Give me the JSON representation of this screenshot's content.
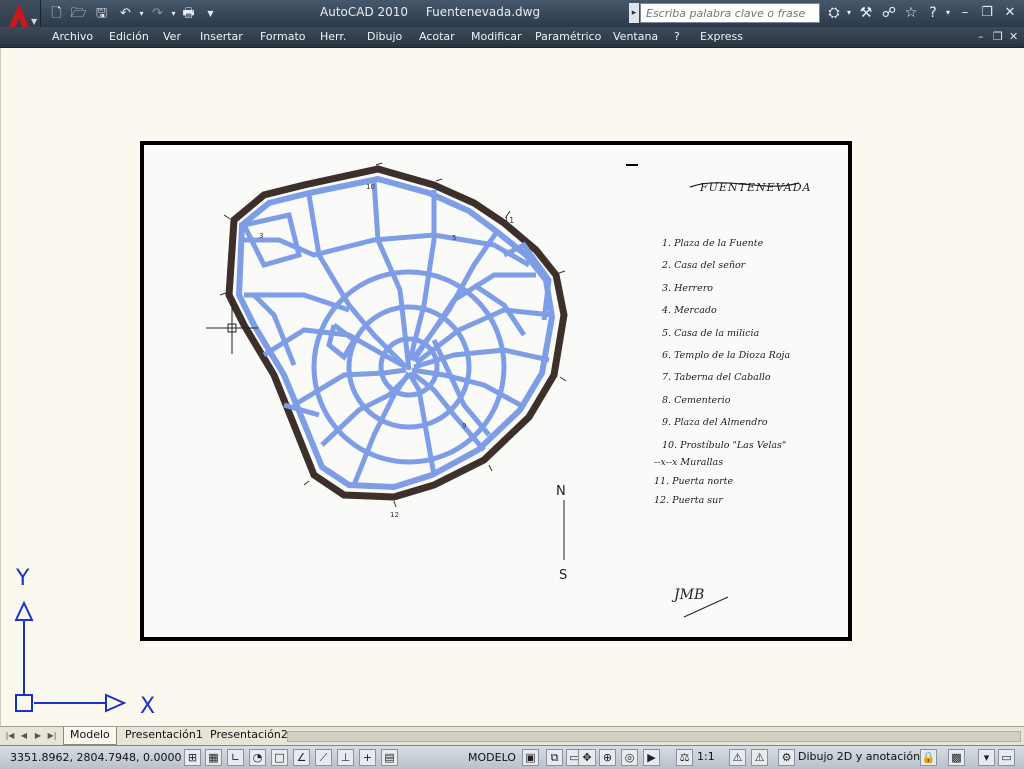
{
  "window": {
    "app_name": "AutoCAD 2010",
    "file_name": "Fuentenevada.dwg",
    "search_placeholder": "Escriba palabra clave o frase"
  },
  "menu": {
    "items": [
      "Archivo",
      "Edición",
      "Ver",
      "Insertar",
      "Formato",
      "Herr.",
      "Dibujo",
      "Acotar",
      "Modificar",
      "Paramétrico",
      "Ventana",
      "?",
      "Express"
    ]
  },
  "drawing": {
    "title": "FUENTENEVADA",
    "legend": [
      "1. Plaza de la Fuente",
      "2. Casa del señor",
      "3. Herrero",
      "4. Mercado",
      "5. Casa de la milicia",
      "6. Templo de la Dioza Roja",
      "7. Taberna del Caballo",
      "8. Cementerio",
      "9. Plaza del Almendro",
      "10. Prostíbulo \"Las Velas\""
    ],
    "legend_extra": [
      "--x--x  Murallas",
      "11. Puerta norte",
      "12. Puerta sur"
    ],
    "compass_n": "N",
    "compass_s": "S",
    "signature": "JMB",
    "map_labels": [
      "10",
      "11",
      "12",
      "3",
      "5",
      "9"
    ]
  },
  "ucs": {
    "x_label": "X",
    "y_label": "Y"
  },
  "tabs": {
    "items": [
      "Modelo",
      "Presentación1",
      "Presentación2"
    ]
  },
  "status": {
    "coords": "3351.8962, 2804.7948, 0.0000",
    "modelo": "MODELO",
    "scale": "1:1",
    "workspace": "Dibujo 2D y anotación"
  },
  "colors": {
    "street": "#7d9ee6",
    "wall": "#3d2f2a",
    "title_bar": "#3a4858"
  }
}
